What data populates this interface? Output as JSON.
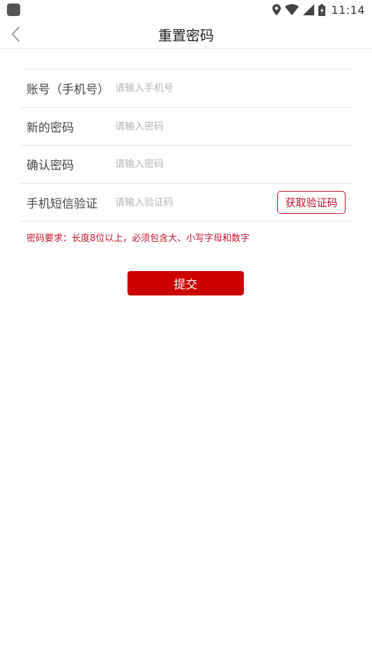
{
  "status_bar": {
    "time": "11:14",
    "icons": [
      "location-icon",
      "wifi-icon",
      "signal-icon",
      "battery-icon"
    ]
  },
  "nav": {
    "title": "重置密码",
    "back_icon": "chevron-left-icon"
  },
  "form": {
    "fields": [
      {
        "label": "账号（手机号）",
        "placeholder": "请输入手机号",
        "value": ""
      },
      {
        "label": "新的密码",
        "placeholder": "请输入密码",
        "value": ""
      },
      {
        "label": "确认密码",
        "placeholder": "请输入密码",
        "value": ""
      },
      {
        "label": "手机短信验证",
        "placeholder": "请输入验证码",
        "value": ""
      }
    ],
    "get_code_label": "获取验证码",
    "requirement": "密码要求：长度8位以上，必须包含大、小写字母和数字",
    "submit_label": "提交"
  },
  "colors": {
    "accent": "#cc0000",
    "requirement_text": "#c8102e",
    "placeholder": "#b5b5b5"
  }
}
